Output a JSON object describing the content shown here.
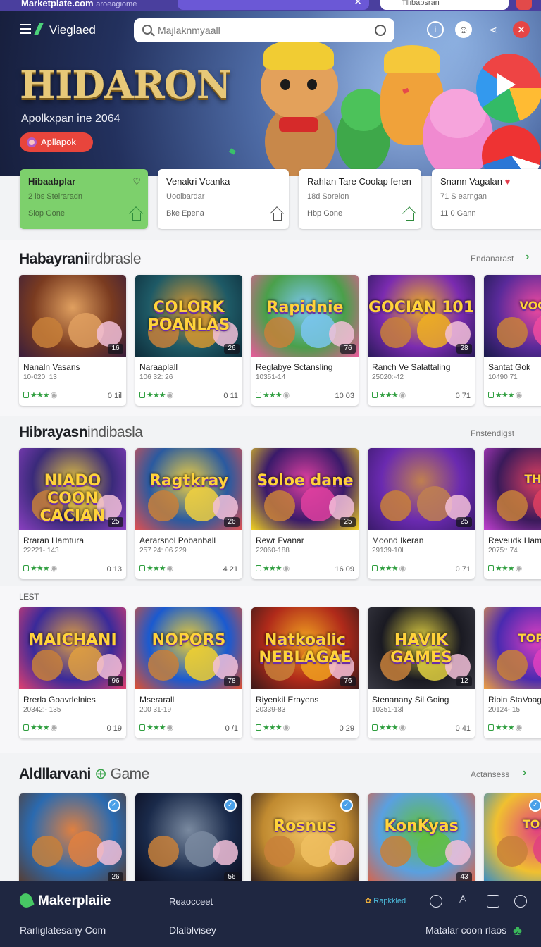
{
  "topbar": {
    "brand": "Marketplate.com",
    "brand_suffix": "aroeagiome",
    "close_glyph": "✕",
    "search_value": "Tllibapsran"
  },
  "navbar": {
    "title": "Vieglaed",
    "search_placeholder": "Majlaknmyaall",
    "icons": [
      "info-icon",
      "avatar-icon",
      "share-icon",
      "close-icon"
    ]
  },
  "hero": {
    "title": "HIDARON",
    "subtitle": "Apolkxpan ine 2064",
    "button_label": "Apllapok"
  },
  "categories": [
    {
      "title": "Hibaabplar",
      "line1": "2 ibs Stelraradn",
      "line2": "Slop Gone",
      "active": true
    },
    {
      "title": "Venakri Vcanka",
      "line1": "Uoolbardar",
      "line2": "Bke Epena",
      "active": false
    },
    {
      "title": "Rahlan Tare Coolap feren",
      "line1": "18d Soreion",
      "line2": "Hbp Gone",
      "active": false
    },
    {
      "title": "Snann Vagalan",
      "line1": "71 S earngan",
      "line2": "11 0 Gann",
      "active": false
    }
  ],
  "sections": [
    {
      "title_bold": "Habayrani",
      "title_light": "irdbrasle",
      "link": "Endanarast",
      "cards": [
        {
          "name": "Nanaln Vasans",
          "meta": "10-020: 13",
          "count": "0 1il",
          "badge": "16"
        },
        {
          "name": "Naraaplall",
          "meta": "106 32: 26",
          "count": "0 11",
          "badge": "26"
        },
        {
          "name": "Reglabye Sctansling",
          "meta": "10351-14",
          "count": "10 03",
          "badge": "76"
        },
        {
          "name": "Ranch Ve Salattaling",
          "meta": "25020:-42",
          "count": "0 71",
          "badge": "28"
        },
        {
          "name": "Santat Gok",
          "meta": "10490 71",
          "count": "",
          "badge": ""
        }
      ]
    },
    {
      "title_bold": "Hibrayasn",
      "title_light": "indibasla",
      "link": "Fnstendigst",
      "cards": [
        {
          "name": "Rraran Hamtura",
          "meta": "22221- 143",
          "count": "0 13",
          "badge": "25"
        },
        {
          "name": "Aerarsnol Pobanball",
          "meta": "257 24: 06 229",
          "count": "4 21",
          "badge": "26"
        },
        {
          "name": "Rewr Fvanar",
          "meta": "22060-188",
          "count": "16 09",
          "badge": "25"
        },
        {
          "name": "Moond Ikeran",
          "meta": "29139-10l",
          "count": "0 71",
          "badge": "25"
        },
        {
          "name": "Reveudk Ham",
          "meta": "2075:: 74",
          "count": "",
          "badge": ""
        }
      ]
    },
    {
      "title_bold": "",
      "title_light": "LEST",
      "link": "",
      "cards": [
        {
          "name": "Rrerla Goavrlelnies",
          "meta": "20342:- 135",
          "count": "0 19",
          "badge": "96"
        },
        {
          "name": "Mserarall",
          "meta": "200 31-19",
          "count": "0 /1",
          "badge": "78"
        },
        {
          "name": "Riyenkil Erayens",
          "meta": "20339-83",
          "count": "0 29",
          "badge": "76"
        },
        {
          "name": "Stenanany Sil Going",
          "meta": "10351-13l",
          "count": "0 41",
          "badge": "12"
        },
        {
          "name": "Rioin StaVoag",
          "meta": "20124- 15",
          "count": "",
          "badge": ""
        }
      ]
    },
    {
      "title_bold": "Aldllarvani",
      "title_light": "Game",
      "link": "Actansess",
      "cards": [
        {
          "name": "",
          "meta": "",
          "count": "",
          "badge": "26"
        },
        {
          "name": "",
          "meta": "",
          "count": "",
          "badge": "56"
        },
        {
          "name": "",
          "meta": "",
          "count": "",
          "badge": ""
        },
        {
          "name": "",
          "meta": "",
          "count": "",
          "badge": "43"
        },
        {
          "name": "",
          "meta": "",
          "count": "",
          "badge": ""
        }
      ]
    }
  ],
  "thumbs": [
    [
      "",
      "COLORK POANLAS",
      "Rapidnie",
      "GOCIAN 101",
      "VOCO"
    ],
    [
      "NIADO COON CACIAN",
      "Ragtkray",
      "Soloe dane",
      "",
      "THU"
    ],
    [
      "MAICHANI",
      "NOPORS",
      "Natkoalic NEBLAGAE",
      "HAVIK GAMES",
      "TOPIA"
    ],
    [
      "",
      "",
      "Rosnus",
      "KonKyas",
      "TOPI"
    ]
  ],
  "footer": {
    "brand": "Makerplaiie",
    "link1": "Reaocceet",
    "rating_text": "Rapkkled",
    "link2": "Rarliglatesany Com",
    "link3": "Dlalblvisey",
    "link4": "Matalar coon rlaos"
  },
  "colors": {
    "accent": "#47c864",
    "hero_button": "#e8453c",
    "footer_bg": "#1f2741"
  }
}
